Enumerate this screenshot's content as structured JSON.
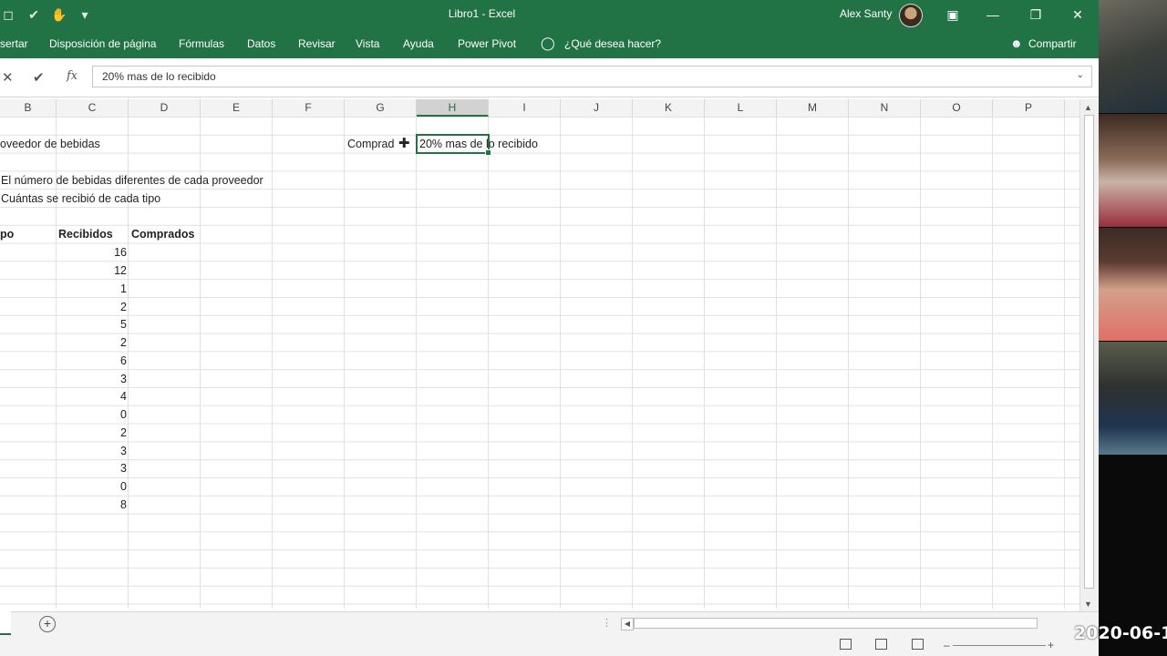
{
  "window": {
    "title": "Libro1  -  Excel",
    "user": "Alex Santy"
  },
  "menu": {
    "tabs": [
      "sertar",
      "Disposición de página",
      "Fórmulas",
      "Datos",
      "Revisar",
      "Vista",
      "Ayuda",
      "Power Pivot"
    ],
    "tell_me": "¿Qué desea hacer?",
    "share": "Compartir"
  },
  "formula_bar": {
    "value": "20% mas de lo recibido",
    "fx": "fx"
  },
  "columns": [
    "B",
    "C",
    "D",
    "E",
    "F",
    "G",
    "H",
    "I",
    "J",
    "K",
    "L",
    "M",
    "N",
    "O",
    "P"
  ],
  "active_column": "H",
  "sheet": {
    "title_fragment": "oveedor de bebidas",
    "g_label": "Comprad",
    "h_note": "20% mas de lo recibido",
    "line1": "El número de bebidas diferentes de cada proveedor",
    "line2": "Cuántas se recibió de cada tipo",
    "header_a": "po",
    "header_recibidos": "Recibidos",
    "header_comprados": "Comprados",
    "recibidos": [
      "16",
      "12",
      "1",
      "2",
      "5",
      "2",
      "6",
      "3",
      "4",
      "0",
      "2",
      "3",
      "3",
      "0",
      "8"
    ]
  },
  "overlay": {
    "timestamp": "2020-06-1"
  },
  "colors": {
    "accent": "#217346"
  }
}
